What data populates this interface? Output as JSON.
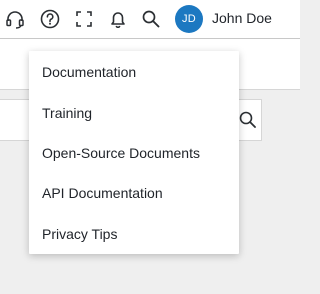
{
  "header": {
    "icons": {
      "support": "headset-icon",
      "help": "help-circle-icon",
      "fullscreen": "fullscreen-icon",
      "notifications": "bell-icon",
      "search": "search-icon"
    },
    "user": {
      "initials": "JD",
      "name": "John Doe",
      "avatar_color": "#1c78c1"
    }
  },
  "help_menu": {
    "items": [
      {
        "label": "Documentation"
      },
      {
        "label": "Training"
      },
      {
        "label": "Open-Source Documents"
      },
      {
        "label": "API Documentation"
      },
      {
        "label": "Privacy Tips"
      }
    ]
  },
  "colors": {
    "page_background": "#efefef",
    "surface": "#ffffff",
    "text": "#1f2329",
    "accent": "#1c78c1"
  }
}
